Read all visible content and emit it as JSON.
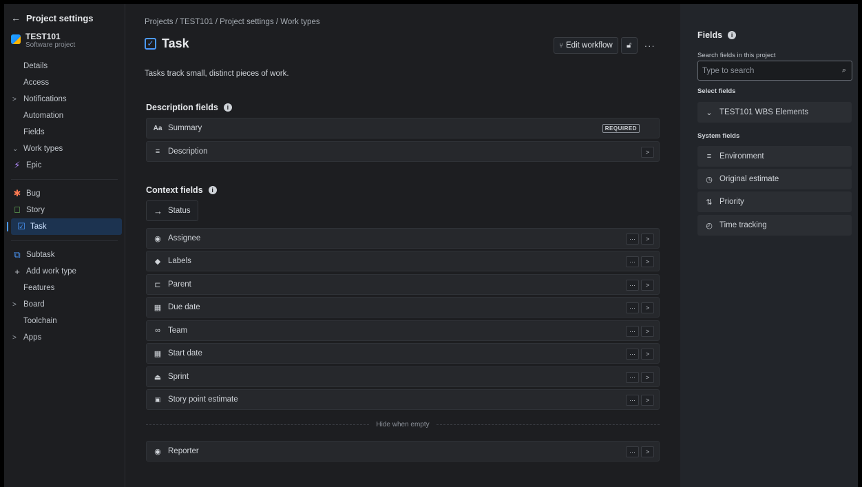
{
  "sidebar": {
    "back_label": "Project settings",
    "project_name": "TEST101",
    "project_type": "Software project",
    "items": [
      {
        "label": "Details"
      },
      {
        "label": "Access"
      },
      {
        "label": "Notifications"
      },
      {
        "label": "Automation"
      },
      {
        "label": "Fields"
      },
      {
        "label": "Work types"
      }
    ],
    "work_types": [
      {
        "label": "Epic",
        "icon": "epic-icon"
      },
      {
        "label": "Bug",
        "icon": "bug-icon"
      },
      {
        "label": "Story",
        "icon": "story-icon"
      },
      {
        "label": "Task",
        "icon": "task-icon"
      },
      {
        "label": "Subtask",
        "icon": "subtask-icon"
      }
    ],
    "add_work_type": "Add work type",
    "tail_items": [
      {
        "label": "Features"
      },
      {
        "label": "Board"
      },
      {
        "label": "Toolchain"
      },
      {
        "label": "Apps"
      }
    ]
  },
  "main": {
    "breadcrumb": "Projects / TEST101 / Project settings / Work types",
    "title": "Task",
    "edit_workflow": "Edit workflow",
    "description": "Tasks track small, distinct pieces of work.",
    "description_fields_title": "Description fields",
    "description_fields": [
      {
        "label": "Summary",
        "badge": "REQUIRED"
      },
      {
        "label": "Description"
      }
    ],
    "context_fields_title": "Context fields",
    "status_label": "Status",
    "context_fields": [
      {
        "label": "Assignee"
      },
      {
        "label": "Labels"
      },
      {
        "label": "Parent"
      },
      {
        "label": "Due date"
      },
      {
        "label": "Team"
      },
      {
        "label": "Start date"
      },
      {
        "label": "Sprint"
      },
      {
        "label": "Story point estimate"
      }
    ],
    "hide_when_empty": "Hide when empty",
    "hidden_fields": [
      {
        "label": "Reporter"
      }
    ]
  },
  "panel": {
    "title": "Fields",
    "search_label": "Search fields in this project",
    "search_placeholder": "Type to search",
    "select_fields_title": "Select fields",
    "select_fields": [
      {
        "label": "TEST101 WBS Elements"
      }
    ],
    "system_fields_title": "System fields",
    "system_fields": [
      {
        "label": "Environment"
      },
      {
        "label": "Original estimate"
      },
      {
        "label": "Priority"
      },
      {
        "label": "Time tracking"
      }
    ]
  },
  "colors": {
    "accent": "#4c9aff",
    "epic": "#b58cff",
    "bug": "#ff7b52",
    "story": "#7ee06c"
  }
}
